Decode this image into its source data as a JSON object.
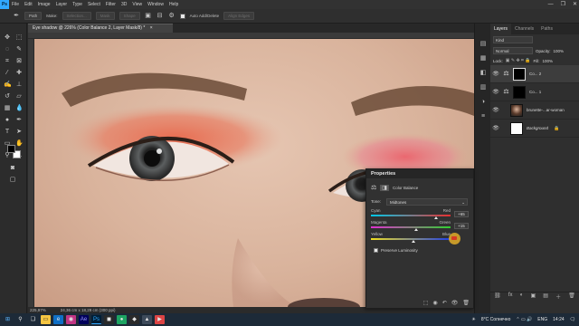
{
  "menu": {
    "logo": "Ps",
    "items": [
      "File",
      "Edit",
      "Image",
      "Layer",
      "Type",
      "Select",
      "Filter",
      "3D",
      "View",
      "Window",
      "Help"
    ],
    "window_controls": [
      "—",
      "❐",
      "✕"
    ]
  },
  "options": {
    "tool_preset": "Path",
    "make_label": "Make:",
    "selection": "Selection...",
    "mask": "Mask",
    "shape": "Shape",
    "auto_add_delete": "Auto Add/Delete",
    "align_edges": "Align Edges"
  },
  "document": {
    "tab_title": "Eye shadow @ 226% (Color Balance 2, Layer Mask/8) *",
    "close": "×"
  },
  "status": {
    "zoom": "225,97%",
    "size": "24,36 cm x 18,29 cm (300 ppi)"
  },
  "layers": {
    "tabs": [
      "Layers",
      "Channels",
      "Paths"
    ],
    "filter_label": "Kind",
    "blend_mode": "Normal",
    "opacity_label": "Opacity:",
    "opacity_value": "100%",
    "lock_label": "Lock:",
    "fill_label": "Fill:",
    "fill_value": "100%",
    "rows": [
      {
        "name": "Co... 2",
        "eye": "👁"
      },
      {
        "name": "Co... 1",
        "eye": "👁"
      },
      {
        "name": "brunette-...ar-woman",
        "eye": "👁"
      },
      {
        "name": "Background",
        "eye": "👁"
      }
    ],
    "footer_icons": [
      "⛓",
      "fx",
      "◐",
      "▣",
      "▤",
      "＋",
      "🗑"
    ]
  },
  "properties": {
    "title": "Properties",
    "adjustment": "Color Balance",
    "tone_label": "Tone:",
    "tone_value": "Midtones",
    "sliders": [
      {
        "left": "Cyan",
        "right": "Red",
        "value": "+65",
        "position": 0.82
      },
      {
        "left": "Magenta",
        "right": "Green",
        "value": "+15",
        "position": 0.57
      },
      {
        "left": "Yellow",
        "right": "Blue",
        "value": "+6",
        "position": 0.53
      }
    ],
    "preserve_luminosity": "Preserve Luminosity",
    "footer_icons": [
      "⬚",
      "◉",
      "↶",
      "👁",
      "🗑"
    ]
  },
  "taskbar": {
    "weather": "8°C Солнечно",
    "language": "ENG",
    "time": "14:24"
  },
  "colors": {
    "accent": "#31a8ff",
    "eyeshadow": "#e8684c",
    "taskbar": "#1d2a38"
  }
}
